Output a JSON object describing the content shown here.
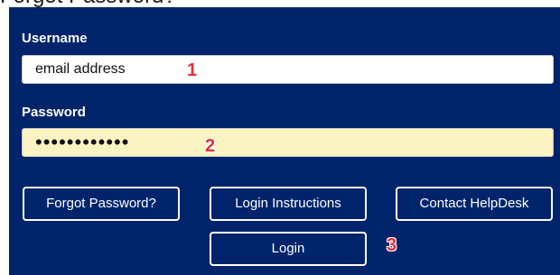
{
  "page": {
    "heading": "Forgot Password?"
  },
  "form": {
    "username": {
      "label": "Username",
      "value": "email address"
    },
    "password": {
      "label": "Password",
      "value": "••••••••••••"
    }
  },
  "buttons": {
    "forgot_password": "Forgot Password?",
    "login_instructions": "Login Instructions",
    "contact_helpdesk": "Contact HelpDesk",
    "login": "Login"
  },
  "annotations": {
    "step1": "1",
    "step2": "2",
    "step3": "3"
  },
  "colors": {
    "panel_background": "#00246b",
    "password_field_background": "#fcf3c2",
    "annotation_marker": "#e0313d"
  }
}
